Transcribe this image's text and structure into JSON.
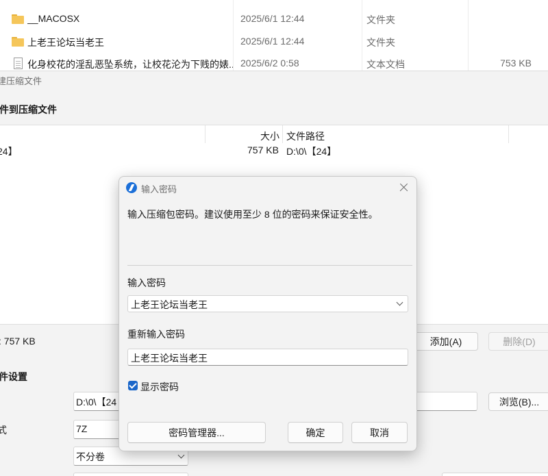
{
  "file_list": {
    "rows": [
      {
        "name": "__MACOSX",
        "date": "2025/6/1 12:44",
        "type": "文件夹",
        "size": "",
        "icon": "folder-icon"
      },
      {
        "name": "上老王论坛当老王",
        "date": "2025/6/1 12:44",
        "type": "文件夹",
        "size": "",
        "icon": "folder-icon"
      },
      {
        "name": "化身校花的淫乱恶坠系统，让校花沦为下贱的婊...",
        "date": "2025/6/2 0:58",
        "type": "文本文档",
        "size": "753 KB",
        "icon": "text-document-icon"
      }
    ]
  },
  "archive_window": {
    "title": "建压缩文件",
    "heading": "件到压缩文件",
    "table": {
      "col_size": "大小",
      "col_path": "文件路径",
      "row_name": "24】",
      "row_size": "757 KB",
      "row_path": "D:\\0\\【24】"
    },
    "total": ": 757 KB",
    "add_button": "添加(A)",
    "delete_button": "删除(D)",
    "settings_heading": "件设置",
    "path_value": "D:\\0\\【24",
    "browse_button": "浏览(B)...",
    "format_label": "式",
    "format_value": "7Z",
    "split_value": "不分卷"
  },
  "password_dialog": {
    "title": "输入密码",
    "description": "输入压缩包密码。建议使用至少 8 位的密码来保证安全性。",
    "password_label": "输入密码",
    "password_value": "上老王论坛当老王",
    "confirm_label": "重新输入密码",
    "confirm_value": "上老王论坛当老王",
    "show_password_label": "显示密码",
    "show_password_checked": true,
    "password_manager_button": "密码管理器...",
    "ok_button": "确定",
    "cancel_button": "取消",
    "accent_color": "#1a66c9"
  }
}
